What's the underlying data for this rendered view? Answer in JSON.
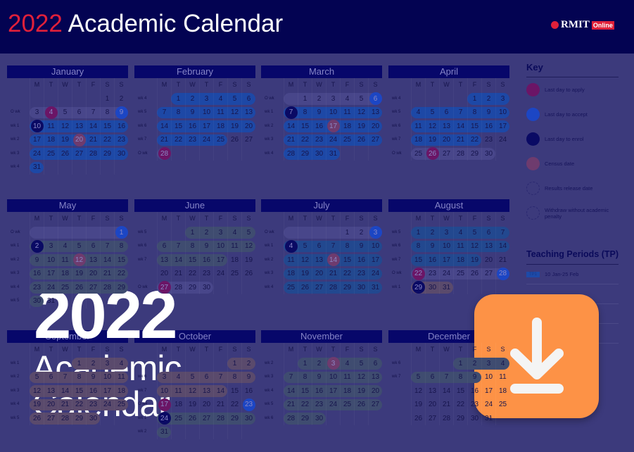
{
  "header": {
    "title_year": "2022",
    "title_text": " Academic Calendar",
    "logo_text": "RMIT",
    "logo_badge": "Online"
  },
  "weekdays": [
    "M",
    "T",
    "W",
    "T",
    "F",
    "S",
    "S"
  ],
  "colors": {
    "apply": "#6b1566",
    "accept": "#1c46c4",
    "enrol": "#0a0a64",
    "census": "#6e3b6e",
    "results": "#3c3a7c",
    "withdraw": "#3c3a7c",
    "blue": "#1d48a6",
    "teal": "#22488f",
    "grey": "#3f4c70",
    "brown": "#5a4a6c",
    "ow": "#48468a"
  },
  "months": [
    {
      "name": "January",
      "first": 5,
      "days": 31,
      "labels": [
        "",
        "O wk",
        "wk 1",
        "wk 2",
        "wk 3",
        "wk 4"
      ],
      "bands": [
        [
          2,
          0,
          6,
          "blue"
        ],
        [
          3,
          0,
          6,
          "blue"
        ],
        [
          4,
          0,
          6,
          "blue"
        ],
        [
          5,
          0,
          0,
          "blue"
        ],
        [
          1,
          0,
          6,
          "ow"
        ]
      ],
      "marks": {
        "4": "apply",
        "9": "accept",
        "10": "enrol",
        "20": "census"
      }
    },
    {
      "name": "February",
      "first": 1,
      "days": 28,
      "labels": [
        "wk 4",
        "wk 5",
        "wk 6",
        "wk 7",
        "O wk"
      ],
      "bands": [
        [
          0,
          1,
          6,
          "blue"
        ],
        [
          1,
          0,
          6,
          "blue"
        ],
        [
          2,
          0,
          6,
          "blue"
        ],
        [
          3,
          0,
          4,
          "blue"
        ],
        [
          4,
          0,
          0,
          "ow"
        ]
      ],
      "marks": {
        "28": "apply"
      }
    },
    {
      "name": "March",
      "first": 1,
      "days": 31,
      "labels": [
        "O wk",
        "wk 1",
        "wk 2",
        "wk 3",
        "wk 4"
      ],
      "bands": [
        [
          0,
          0,
          6,
          "ow"
        ],
        [
          1,
          0,
          6,
          "blue"
        ],
        [
          2,
          0,
          6,
          "blue"
        ],
        [
          3,
          0,
          6,
          "blue"
        ],
        [
          4,
          0,
          3,
          "blue"
        ]
      ],
      "marks": {
        "6": "accept",
        "7": "enrol",
        "17": "census"
      }
    },
    {
      "name": "April",
      "first": 4,
      "days": 30,
      "labels": [
        "wk 4",
        "wk 5",
        "wk 6",
        "wk 7",
        "O wk"
      ],
      "bands": [
        [
          0,
          4,
          6,
          "blue"
        ],
        [
          1,
          0,
          6,
          "blue"
        ],
        [
          2,
          0,
          6,
          "blue"
        ],
        [
          3,
          0,
          4,
          "blue"
        ],
        [
          4,
          0,
          5,
          "ow"
        ]
      ],
      "marks": {
        "26": "apply"
      }
    },
    {
      "name": "May",
      "first": 6,
      "days": 31,
      "labels": [
        "O wk",
        "wk 1",
        "wk 2",
        "wk 3",
        "wk 4",
        "wk 5"
      ],
      "bands": [
        [
          0,
          0,
          6,
          "ow"
        ],
        [
          1,
          0,
          6,
          "grey"
        ],
        [
          2,
          0,
          6,
          "grey"
        ],
        [
          3,
          0,
          6,
          "grey"
        ],
        [
          4,
          0,
          6,
          "grey"
        ],
        [
          5,
          0,
          0,
          "grey"
        ]
      ],
      "marks": {
        "1": "accept",
        "2": "enrol",
        "12": "census"
      }
    },
    {
      "name": "June",
      "first": 2,
      "days": 30,
      "labels": [
        "wk 5",
        "wk 6",
        "wk 7",
        "",
        "O wk"
      ],
      "bands": [
        [
          0,
          2,
          6,
          "grey"
        ],
        [
          1,
          0,
          6,
          "grey"
        ],
        [
          2,
          0,
          4,
          "grey"
        ],
        [
          4,
          0,
          3,
          "ow"
        ]
      ],
      "marks": {
        "27": "apply"
      }
    },
    {
      "name": "July",
      "first": 4,
      "days": 31,
      "labels": [
        "O wk",
        "wk 1",
        "wk 2",
        "wk 3",
        "wk 4"
      ],
      "bands": [
        [
          0,
          0,
          6,
          "ow"
        ],
        [
          1,
          0,
          6,
          "teal"
        ],
        [
          2,
          0,
          6,
          "teal"
        ],
        [
          3,
          0,
          6,
          "teal"
        ],
        [
          4,
          0,
          6,
          "teal"
        ]
      ],
      "marks": {
        "3": "accept",
        "4": "enrol",
        "14": "census"
      }
    },
    {
      "name": "August",
      "first": 0,
      "days": 31,
      "labels": [
        "wk 5",
        "wk 6",
        "wk 7",
        "O wk",
        "wk 1"
      ],
      "bands": [
        [
          0,
          0,
          6,
          "teal"
        ],
        [
          1,
          0,
          6,
          "teal"
        ],
        [
          2,
          0,
          4,
          "teal"
        ],
        [
          3,
          0,
          6,
          "ow"
        ],
        [
          4,
          0,
          2,
          "brown"
        ]
      ],
      "marks": {
        "22": "apply",
        "28": "accept",
        "29": "enrol"
      }
    },
    {
      "name": "September",
      "first": 3,
      "days": 30,
      "labels": [
        "wk 1",
        "wk 2",
        "wk 3",
        "wk 4",
        "wk 5"
      ],
      "bands": [
        [
          0,
          3,
          6,
          "brown"
        ],
        [
          1,
          0,
          6,
          "brown"
        ],
        [
          2,
          0,
          6,
          "brown"
        ],
        [
          3,
          0,
          6,
          "brown"
        ],
        [
          4,
          0,
          4,
          "brown"
        ]
      ],
      "marks": {}
    },
    {
      "name": "October",
      "first": 5,
      "days": 31,
      "labels": [
        "",
        "wk 6",
        "wk 7",
        "O wk",
        "wk 1",
        "wk 2"
      ],
      "bands": [
        [
          0,
          5,
          6,
          "brown"
        ],
        [
          1,
          0,
          6,
          "brown"
        ],
        [
          2,
          0,
          4,
          "brown"
        ],
        [
          4,
          0,
          6,
          "grey"
        ],
        [
          5,
          0,
          0,
          "grey"
        ]
      ],
      "marks": {
        "17": "apply",
        "23": "accept",
        "24": "enrol"
      }
    },
    {
      "name": "November",
      "first": 1,
      "days": 30,
      "labels": [
        "wk 2",
        "wk 3",
        "wk 4",
        "wk 5",
        "wk 6"
      ],
      "bands": [
        [
          0,
          1,
          6,
          "grey"
        ],
        [
          1,
          0,
          6,
          "grey"
        ],
        [
          2,
          0,
          6,
          "grey"
        ],
        [
          3,
          0,
          6,
          "grey"
        ],
        [
          4,
          0,
          2,
          "grey"
        ]
      ],
      "marks": {
        "3": "census"
      }
    },
    {
      "name": "December",
      "first": 3,
      "days": 31,
      "labels": [
        "wk 6",
        "wk 7",
        "",
        "",
        ""
      ],
      "bands": [
        [
          0,
          3,
          6,
          "grey"
        ],
        [
          1,
          0,
          4,
          "grey"
        ]
      ],
      "marks": {}
    }
  ],
  "key": {
    "title": "Key",
    "items": [
      {
        "label": "Last day to apply",
        "type": "apply"
      },
      {
        "label": "Last day to accept",
        "type": "accept"
      },
      {
        "label": "Last day to enrol",
        "type": "enrol"
      },
      {
        "label": "Census date",
        "type": "census"
      },
      {
        "label": "Results release date",
        "type": "results"
      },
      {
        "label": "Withdraw without academic penalty",
        "type": "withdraw"
      }
    ]
  },
  "teaching_periods": {
    "title": "Teaching Periods (TP)",
    "items": [
      {
        "badge": "TP1",
        "dates": "10 Jan-25 Feb"
      }
    ]
  },
  "overlay": {
    "year": "2022",
    "line1": "Academic",
    "line2": "Calendar"
  },
  "download": {
    "icon": "download-arrow-icon",
    "color": "#fd9246"
  }
}
